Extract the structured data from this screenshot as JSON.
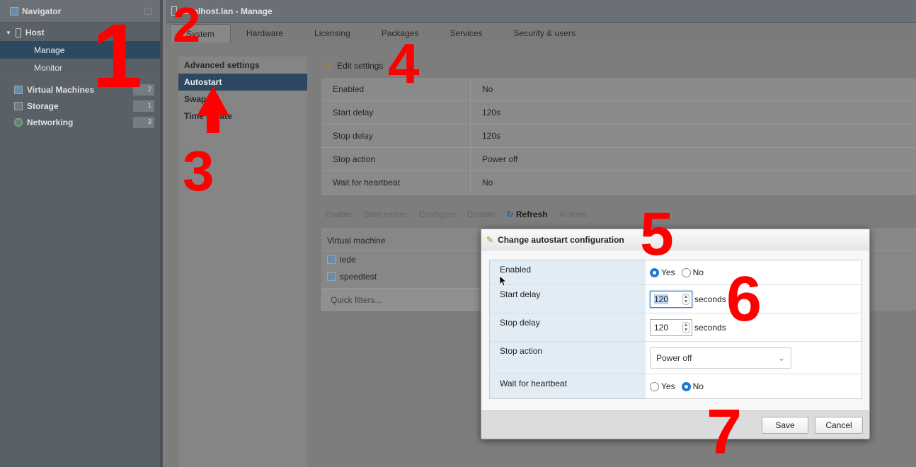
{
  "navigator": {
    "title": "Navigator",
    "host": "Host",
    "manage": "Manage",
    "monitor": "Monitor",
    "items": [
      {
        "label": "Virtual Machines",
        "count": "2",
        "icon": "vm-icon"
      },
      {
        "label": "Storage",
        "count": "1",
        "icon": "storage-icon"
      },
      {
        "label": "Networking",
        "count": "3",
        "icon": "network-icon"
      }
    ]
  },
  "main": {
    "title": "localhost.lan - Manage",
    "tabs": [
      "System",
      "Hardware",
      "Licensing",
      "Packages",
      "Services",
      "Security & users"
    ]
  },
  "side_menu": [
    "Advanced settings",
    "Autostart",
    "Swap",
    "Time & date"
  ],
  "edit_settings": "Edit settings",
  "settings": [
    {
      "key": "Enabled",
      "value": "No"
    },
    {
      "key": "Start delay",
      "value": "120s"
    },
    {
      "key": "Stop delay",
      "value": "120s"
    },
    {
      "key": "Stop action",
      "value": "Power off"
    },
    {
      "key": "Wait for heartbeat",
      "value": "No"
    }
  ],
  "actions": {
    "enable": "Enable",
    "start_earlier": "Start earlier",
    "configure": "Configure",
    "disable": "Disable",
    "refresh": "Refresh",
    "actions": "Actions"
  },
  "vm_table": {
    "header": "Virtual machine",
    "rows": [
      "lede",
      "speedtest"
    ],
    "filter": "Quick filters..."
  },
  "dialog": {
    "title": "Change autostart configuration",
    "enabled_label": "Enabled",
    "yes": "Yes",
    "no": "No",
    "start_delay_label": "Start delay",
    "start_delay_value": "120",
    "stop_delay_label": "Stop delay",
    "stop_delay_value": "120",
    "seconds": "seconds",
    "stop_action_label": "Stop action",
    "stop_action_value": "Power off",
    "heartbeat_label": "Wait for heartbeat",
    "save": "Save",
    "cancel": "Cancel"
  },
  "annotations": [
    "1",
    "2",
    "3",
    "4",
    "5",
    "6",
    "7"
  ]
}
